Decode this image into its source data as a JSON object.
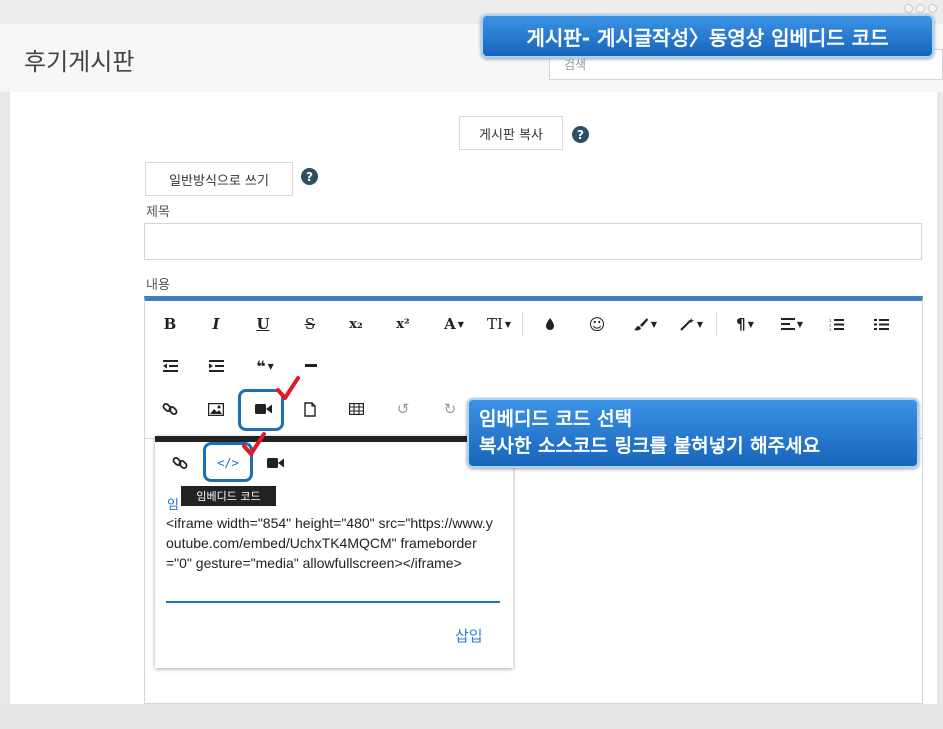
{
  "page": {
    "title": "후기게시판",
    "search_placeholder": "검색"
  },
  "actions": {
    "copy_board": "게시판 복사",
    "plain_mode": "일반방식으로 쓰기"
  },
  "fields": {
    "subject_label": "제목",
    "content_label": "내용"
  },
  "toolbar": {
    "bold": "B",
    "italic": "I",
    "underline": "U",
    "strike": "S",
    "subscript": "x₂",
    "superscript": "x²",
    "font_family": "A",
    "font_size": "TI"
  },
  "popup": {
    "tooltip": "임베디드 코드",
    "label": "임",
    "embed_code": "<iframe width=\"854\" height=\"480\" src=\"https://www.youtube.com/embed/UchxTK4MQCM\" frameborder=\"0\" gesture=\"media\" allowfullscreen></iframe>",
    "insert": "삽입"
  },
  "callouts": {
    "top": "게시판- 게시글작성〉동영상 임베디드 코드",
    "mid_line1": "임베디드 코드 선택",
    "mid_line2": "복사한 소스코드 링크를 붙혀넣기 해주세요"
  },
  "colors": {
    "accent": "#3e7fc1",
    "callout": "#1f73c6",
    "checkmark": "#e01b24"
  }
}
